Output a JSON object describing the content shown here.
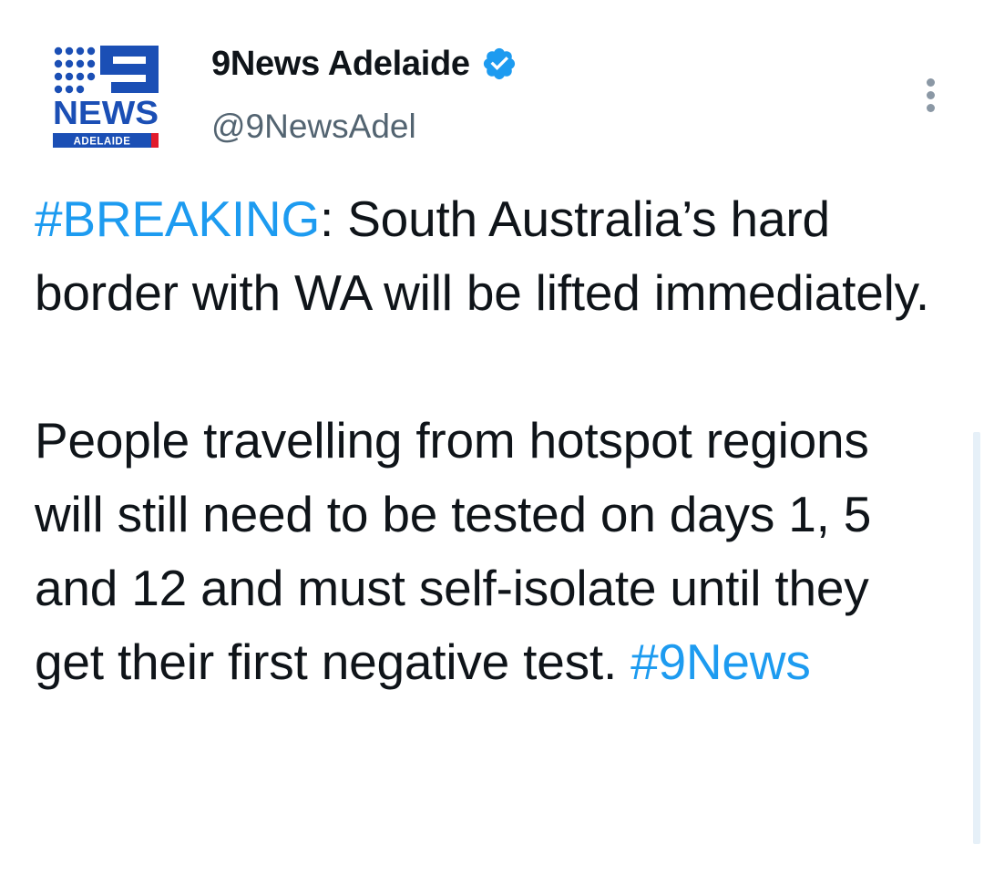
{
  "account": {
    "display_name": "9News Adelaide",
    "handle": "@9NewsAdel",
    "verified": true,
    "logo": {
      "icon": "9news-adelaide-logo",
      "wordmark": "NEWS",
      "region": "ADELAIDE",
      "colors": {
        "blue": "#1b4fb5",
        "red": "#e21b2c"
      }
    }
  },
  "menu": {
    "icon": "more-vertical-icon"
  },
  "tweet": {
    "paragraph1": {
      "hashtag": "#BREAKING",
      "text": ": South Australia’s hard border with WA will be lifted immediately."
    },
    "paragraph2": {
      "text": "People travelling from hotspot regions will still need to be tested on days 1, 5 and 12 and must self-isolate until they get their first negative test. ",
      "hashtag": "#9News"
    }
  },
  "colors": {
    "link": "#1d9bf0",
    "text": "#0f1419",
    "secondary": "#536471",
    "verified_badge": "#1d9bf0"
  }
}
